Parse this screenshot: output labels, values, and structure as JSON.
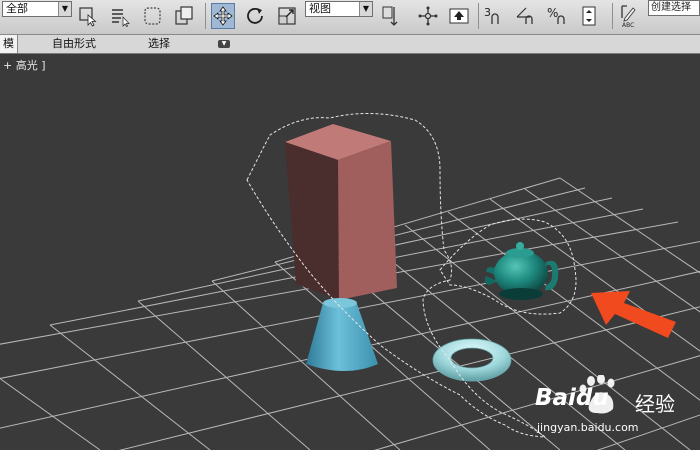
{
  "toolbar": {
    "selection_filter": "全部",
    "reference_coord": "视图",
    "named_selection": "创建选择"
  },
  "ribbon": {
    "tabs": [
      {
        "label": "模",
        "active": true
      },
      {
        "label": "自由形式",
        "active": false
      },
      {
        "label": "选择",
        "active": false
      }
    ]
  },
  "viewport": {
    "label": "+ 高光 ]",
    "objects": [
      "box",
      "cone",
      "torus",
      "teapot"
    ],
    "colors": {
      "background": "#3a3a3a",
      "grid": "#bdbdbd",
      "box": "#c07a78",
      "cone": "#4aa3c2",
      "torus": "#9fd8dc",
      "teapot": "#1f8a80",
      "arrow": "#f04a1e"
    }
  },
  "watermark": {
    "brand": "Baidu",
    "service": "经验",
    "url": "jingyan.baidu.com"
  }
}
